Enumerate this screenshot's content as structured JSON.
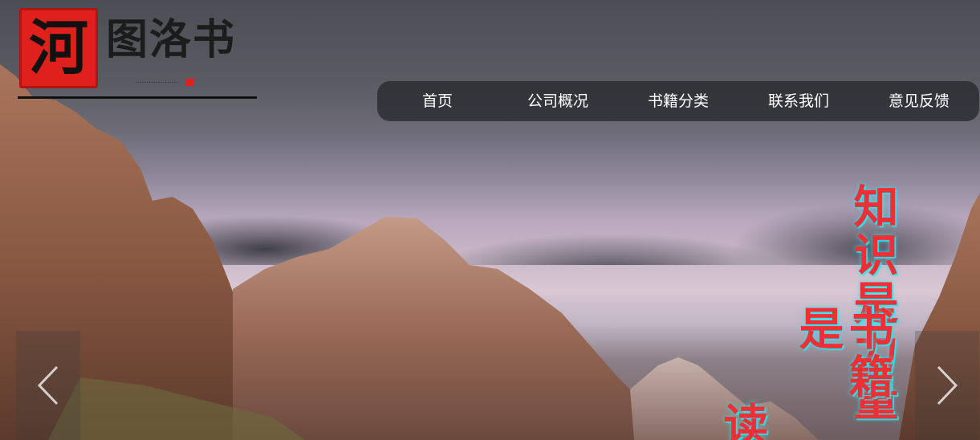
{
  "logo": {
    "seal_char": "河",
    "text": "图洛书",
    "small_text": "...................",
    "accent_color": "#e0201c"
  },
  "nav": {
    "items": [
      {
        "label": "首页"
      },
      {
        "label": "公司概况"
      },
      {
        "label": "书籍分类"
      },
      {
        "label": "联系我们"
      },
      {
        "label": "意见反馈"
      }
    ]
  },
  "banner": {
    "slogan_line1": "知识是力量",
    "slogan_line2": "书籍是",
    "slogan_line3": "读",
    "slogan_color": "#ef2e35",
    "glow_color": "#28e6f0"
  },
  "carousel": {
    "prev_icon": "chevron-left-icon",
    "next_icon": "chevron-right-icon"
  }
}
